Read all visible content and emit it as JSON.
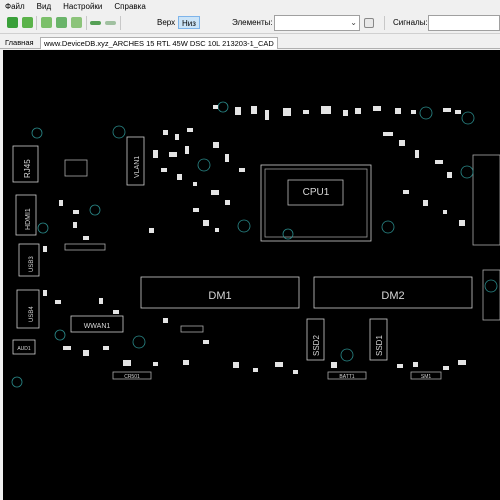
{
  "menu": {
    "file": "Файл",
    "view": "Вид",
    "settings": "Настройки",
    "help": "Справка"
  },
  "toolbar": {
    "top_label": "Верх",
    "bottom_label": "Низ",
    "elements_label": "Элементы:",
    "elements_value": "",
    "signals_label": "Сигналы:",
    "signals_value": ""
  },
  "tabs": {
    "home": "Главная",
    "document": "www.DeviceDB.xyz_ARCHES 15 RTL 45W DSC 10L 213203-1_CAD"
  },
  "board": {
    "cpu": "CPU1",
    "dimm1": "DM1",
    "dimm2": "DM2",
    "ssd2": "SSD2",
    "ssd1": "SSD1",
    "rj45": "RJ45",
    "vlan": "VLAN1",
    "hdmi": "HDMI1",
    "usb3": "USB3",
    "usb4": "USB4",
    "wwan": "WWAN1",
    "aud": "AUD1",
    "cr": "CR501",
    "batt": "BATT1",
    "sm": "SM1"
  },
  "colors": {
    "board_bg": "#000000",
    "outline": "#d0d0d0",
    "circle": "#2a8a8a",
    "highlight_toggle": "#cce4f7"
  }
}
